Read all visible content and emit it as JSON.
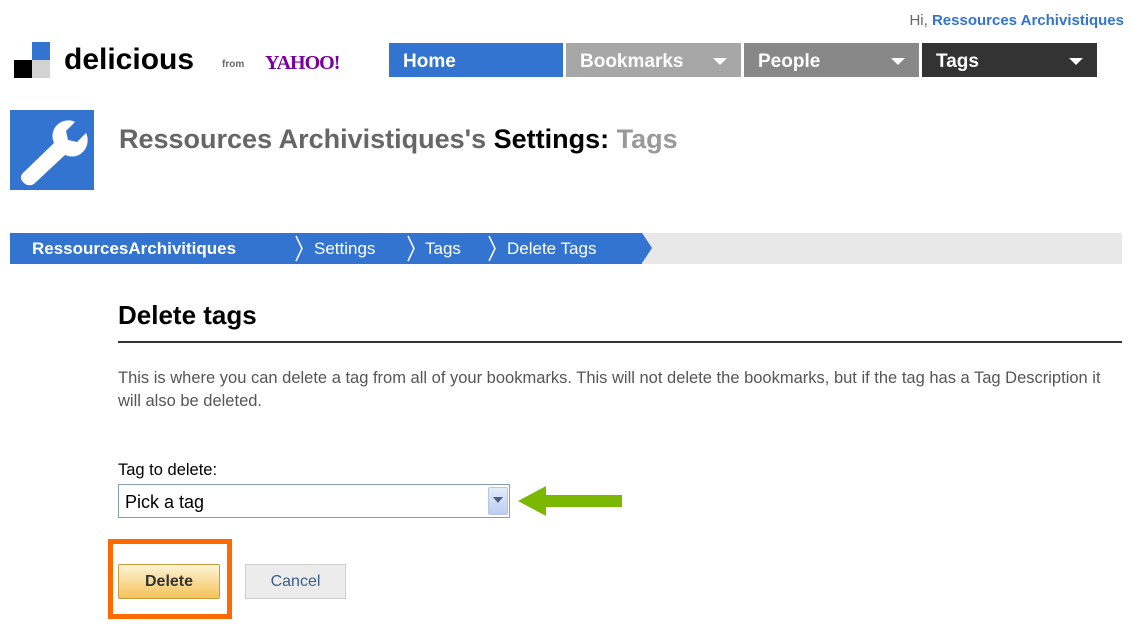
{
  "header": {
    "greeting_prefix": "Hi,",
    "user_name": "Ressources Archivistiques",
    "logo_text": "delicious",
    "logo_from": "from",
    "logo_yahoo": "YAHOO!"
  },
  "nav": {
    "tabs": [
      {
        "label": "Home"
      },
      {
        "label": "Bookmarks"
      },
      {
        "label": "People"
      },
      {
        "label": "Tags"
      }
    ]
  },
  "settings": {
    "title_user": "Ressources Archivistiques's",
    "title_settings": "Settings:",
    "title_section": "Tags"
  },
  "breadcrumb": [
    "RessourcesArchivitiques",
    "Settings",
    "Tags",
    "Delete Tags"
  ],
  "main": {
    "heading": "Delete tags",
    "description": "This is where you can delete a tag from all of your bookmarks. This will not delete the bookmarks, but if the tag has a Tag Description it will also be deleted.",
    "field_label": "Tag to delete:",
    "select_value": "Pick a tag",
    "delete_label": "Delete",
    "cancel_label": "Cancel"
  },
  "annotations": {
    "arrow_color": "#7ab800",
    "highlight_color": "#ff6a00"
  },
  "colors": {
    "brand_blue": "#3274d0"
  }
}
